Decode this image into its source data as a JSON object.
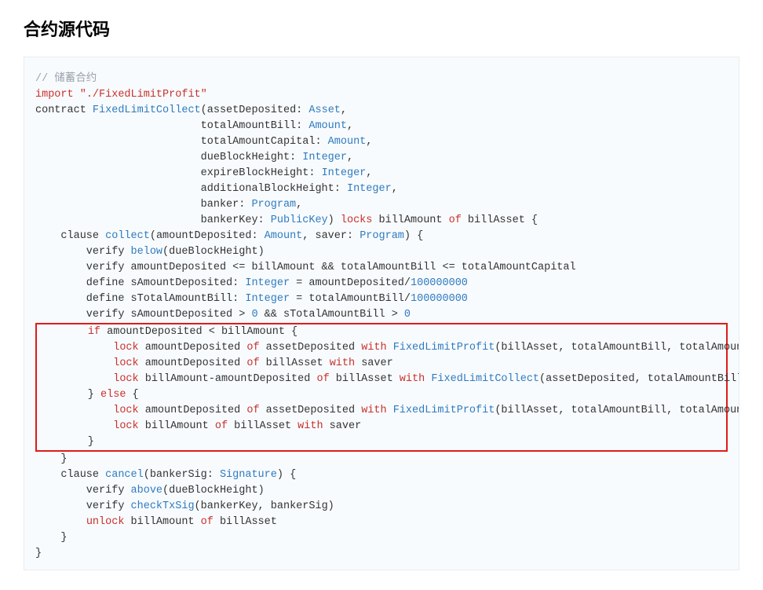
{
  "title": "合约源代码",
  "code": {
    "pre_lines": [
      [
        {
          "c": "tok-comment",
          "t": "// 储蓄合约"
        }
      ],
      [
        {
          "c": "tok-keyword",
          "t": "import"
        },
        {
          "c": "",
          "t": " "
        },
        {
          "c": "tok-string",
          "t": "\"./FixedLimitProfit\""
        }
      ],
      [
        {
          "c": "",
          "t": "contract "
        },
        {
          "c": "tok-type",
          "t": "FixedLimitCollect"
        },
        {
          "c": "",
          "t": "(assetDeposited: "
        },
        {
          "c": "tok-type",
          "t": "Asset"
        },
        {
          "c": "",
          "t": ","
        }
      ],
      [
        {
          "c": "",
          "t": "                          totalAmountBill: "
        },
        {
          "c": "tok-type",
          "t": "Amount"
        },
        {
          "c": "",
          "t": ","
        }
      ],
      [
        {
          "c": "",
          "t": "                          totalAmountCapital: "
        },
        {
          "c": "tok-type",
          "t": "Amount"
        },
        {
          "c": "",
          "t": ","
        }
      ],
      [
        {
          "c": "",
          "t": "                          dueBlockHeight: "
        },
        {
          "c": "tok-type",
          "t": "Integer"
        },
        {
          "c": "",
          "t": ","
        }
      ],
      [
        {
          "c": "",
          "t": "                          expireBlockHeight: "
        },
        {
          "c": "tok-type",
          "t": "Integer"
        },
        {
          "c": "",
          "t": ","
        }
      ],
      [
        {
          "c": "",
          "t": "                          additionalBlockHeight: "
        },
        {
          "c": "tok-type",
          "t": "Integer"
        },
        {
          "c": "",
          "t": ","
        }
      ],
      [
        {
          "c": "",
          "t": "                          banker: "
        },
        {
          "c": "tok-type",
          "t": "Program"
        },
        {
          "c": "",
          "t": ","
        }
      ],
      [
        {
          "c": "",
          "t": "                          bankerKey: "
        },
        {
          "c": "tok-type",
          "t": "PublicKey"
        },
        {
          "c": "",
          "t": ") "
        },
        {
          "c": "tok-keyword",
          "t": "locks"
        },
        {
          "c": "",
          "t": " billAmount "
        },
        {
          "c": "tok-keyword",
          "t": "of"
        },
        {
          "c": "",
          "t": " billAsset {"
        }
      ],
      [
        {
          "c": "",
          "t": "    clause "
        },
        {
          "c": "tok-func",
          "t": "collect"
        },
        {
          "c": "",
          "t": "(amountDeposited: "
        },
        {
          "c": "tok-type",
          "t": "Amount"
        },
        {
          "c": "",
          "t": ", saver: "
        },
        {
          "c": "tok-type",
          "t": "Program"
        },
        {
          "c": "",
          "t": ") {"
        }
      ],
      [
        {
          "c": "",
          "t": "        verify "
        },
        {
          "c": "tok-func",
          "t": "below"
        },
        {
          "c": "",
          "t": "(dueBlockHeight)"
        }
      ],
      [
        {
          "c": "",
          "t": "        verify amountDeposited <= billAmount && totalAmountBill <= totalAmountCapital"
        }
      ],
      [
        {
          "c": "",
          "t": "        define sAmountDeposited: "
        },
        {
          "c": "tok-type",
          "t": "Integer"
        },
        {
          "c": "",
          "t": " = amountDeposited/"
        },
        {
          "c": "tok-number",
          "t": "100000000"
        }
      ],
      [
        {
          "c": "",
          "t": "        define sTotalAmountBill: "
        },
        {
          "c": "tok-type",
          "t": "Integer"
        },
        {
          "c": "",
          "t": " = totalAmountBill/"
        },
        {
          "c": "tok-number",
          "t": "100000000"
        }
      ],
      [
        {
          "c": "",
          "t": "        verify sAmountDeposited > "
        },
        {
          "c": "tok-number",
          "t": "0"
        },
        {
          "c": "",
          "t": " && sTotalAmountBill > "
        },
        {
          "c": "tok-number",
          "t": "0"
        }
      ]
    ],
    "highlight_lines": [
      [
        {
          "c": "",
          "t": "        "
        },
        {
          "c": "tok-keyword",
          "t": "if"
        },
        {
          "c": "",
          "t": " amountDeposited < billAmount {"
        }
      ],
      [
        {
          "c": "",
          "t": "            "
        },
        {
          "c": "tok-keyword",
          "t": "lock"
        },
        {
          "c": "",
          "t": " amountDeposited "
        },
        {
          "c": "tok-keyword",
          "t": "of"
        },
        {
          "c": "",
          "t": " assetDeposited "
        },
        {
          "c": "tok-keyword",
          "t": "with"
        },
        {
          "c": "",
          "t": " "
        },
        {
          "c": "tok-type",
          "t": "FixedLimitProfit"
        },
        {
          "c": "",
          "t": "(billAsset, totalAmountBill, totalAmountCapital,"
        }
      ],
      [
        {
          "c": "",
          "t": "            "
        },
        {
          "c": "tok-keyword",
          "t": "lock"
        },
        {
          "c": "",
          "t": " amountDeposited "
        },
        {
          "c": "tok-keyword",
          "t": "of"
        },
        {
          "c": "",
          "t": " billAsset "
        },
        {
          "c": "tok-keyword",
          "t": "with"
        },
        {
          "c": "",
          "t": " saver"
        }
      ],
      [
        {
          "c": "",
          "t": "            "
        },
        {
          "c": "tok-keyword",
          "t": "lock"
        },
        {
          "c": "",
          "t": " billAmount-amountDeposited "
        },
        {
          "c": "tok-keyword",
          "t": "of"
        },
        {
          "c": "",
          "t": " billAsset "
        },
        {
          "c": "tok-keyword",
          "t": "with"
        },
        {
          "c": "",
          "t": " "
        },
        {
          "c": "tok-type",
          "t": "FixedLimitCollect"
        },
        {
          "c": "",
          "t": "(assetDeposited, totalAmountBill,"
        }
      ],
      [
        {
          "c": "",
          "t": "        } "
        },
        {
          "c": "tok-keyword",
          "t": "else"
        },
        {
          "c": "",
          "t": " {"
        }
      ],
      [
        {
          "c": "",
          "t": "            "
        },
        {
          "c": "tok-keyword",
          "t": "lock"
        },
        {
          "c": "",
          "t": " amountDeposited "
        },
        {
          "c": "tok-keyword",
          "t": "of"
        },
        {
          "c": "",
          "t": " assetDeposited "
        },
        {
          "c": "tok-keyword",
          "t": "with"
        },
        {
          "c": "",
          "t": " "
        },
        {
          "c": "tok-type",
          "t": "FixedLimitProfit"
        },
        {
          "c": "",
          "t": "(billAsset, totalAmountBill, totalAmountCapital,"
        }
      ],
      [
        {
          "c": "",
          "t": "            "
        },
        {
          "c": "tok-keyword",
          "t": "lock"
        },
        {
          "c": "",
          "t": " billAmount "
        },
        {
          "c": "tok-keyword",
          "t": "of"
        },
        {
          "c": "",
          "t": " billAsset "
        },
        {
          "c": "tok-keyword",
          "t": "with"
        },
        {
          "c": "",
          "t": " saver"
        }
      ],
      [
        {
          "c": "",
          "t": "        }"
        }
      ]
    ],
    "post_lines": [
      [
        {
          "c": "",
          "t": "    }"
        }
      ],
      [
        {
          "c": "",
          "t": "    clause "
        },
        {
          "c": "tok-func",
          "t": "cancel"
        },
        {
          "c": "",
          "t": "(bankerSig: "
        },
        {
          "c": "tok-type",
          "t": "Signature"
        },
        {
          "c": "",
          "t": ") {"
        }
      ],
      [
        {
          "c": "",
          "t": "        verify "
        },
        {
          "c": "tok-func",
          "t": "above"
        },
        {
          "c": "",
          "t": "(dueBlockHeight)"
        }
      ],
      [
        {
          "c": "",
          "t": "        verify "
        },
        {
          "c": "tok-func",
          "t": "checkTxSig"
        },
        {
          "c": "",
          "t": "(bankerKey, bankerSig)"
        }
      ],
      [
        {
          "c": "",
          "t": "        "
        },
        {
          "c": "tok-keyword",
          "t": "unlock"
        },
        {
          "c": "",
          "t": " billAmount "
        },
        {
          "c": "tok-keyword",
          "t": "of"
        },
        {
          "c": "",
          "t": " billAsset"
        }
      ],
      [
        {
          "c": "",
          "t": "    }"
        }
      ],
      [
        {
          "c": "",
          "t": "}"
        }
      ]
    ]
  }
}
